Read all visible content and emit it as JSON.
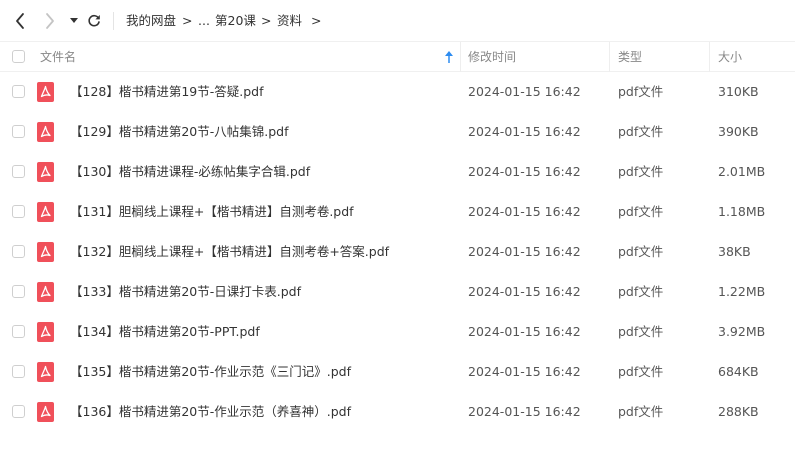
{
  "colors": {
    "pdf_icon": "#f0505a",
    "sort_arrow": "#2d8cf0",
    "text": "#333333",
    "muted": "#888888"
  },
  "breadcrumb": {
    "items": [
      "我的网盘",
      "...",
      "第20课",
      "资料"
    ],
    "separator": ">"
  },
  "columns": {
    "name": "文件名",
    "modified": "修改时间",
    "type": "类型",
    "size": "大小"
  },
  "files": [
    {
      "name": "【128】楷书精进第19节-答疑.pdf",
      "modified": "2024-01-15 16:42",
      "type": "pdf文件",
      "size": "310KB",
      "icon": "pdf-icon"
    },
    {
      "name": "【129】楷书精进第20节-八帖集锦.pdf",
      "modified": "2024-01-15 16:42",
      "type": "pdf文件",
      "size": "390KB",
      "icon": "pdf-icon"
    },
    {
      "name": "【130】楷书精进课程-必练帖集字合辑.pdf",
      "modified": "2024-01-15 16:42",
      "type": "pdf文件",
      "size": "2.01MB",
      "icon": "pdf-icon"
    },
    {
      "name": "【131】胆榈线上课程+【楷书精进】自测考卷.pdf",
      "modified": "2024-01-15 16:42",
      "type": "pdf文件",
      "size": "1.18MB",
      "icon": "pdf-icon"
    },
    {
      "name": "【132】胆榈线上课程+【楷书精进】自测考卷+答案.pdf",
      "modified": "2024-01-15 16:42",
      "type": "pdf文件",
      "size": "38KB",
      "icon": "pdf-icon"
    },
    {
      "name": "【133】楷书精进第20节-日课打卡表.pdf",
      "modified": "2024-01-15 16:42",
      "type": "pdf文件",
      "size": "1.22MB",
      "icon": "pdf-icon"
    },
    {
      "name": "【134】楷书精进第20节-PPT.pdf",
      "modified": "2024-01-15 16:42",
      "type": "pdf文件",
      "size": "3.92MB",
      "icon": "pdf-icon"
    },
    {
      "name": "【135】楷书精进第20节-作业示范《三门记》.pdf",
      "modified": "2024-01-15 16:42",
      "type": "pdf文件",
      "size": "684KB",
      "icon": "pdf-icon"
    },
    {
      "name": "【136】楷书精进第20节-作业示范（养喜神）.pdf",
      "modified": "2024-01-15 16:42",
      "type": "pdf文件",
      "size": "288KB",
      "icon": "pdf-icon"
    }
  ]
}
